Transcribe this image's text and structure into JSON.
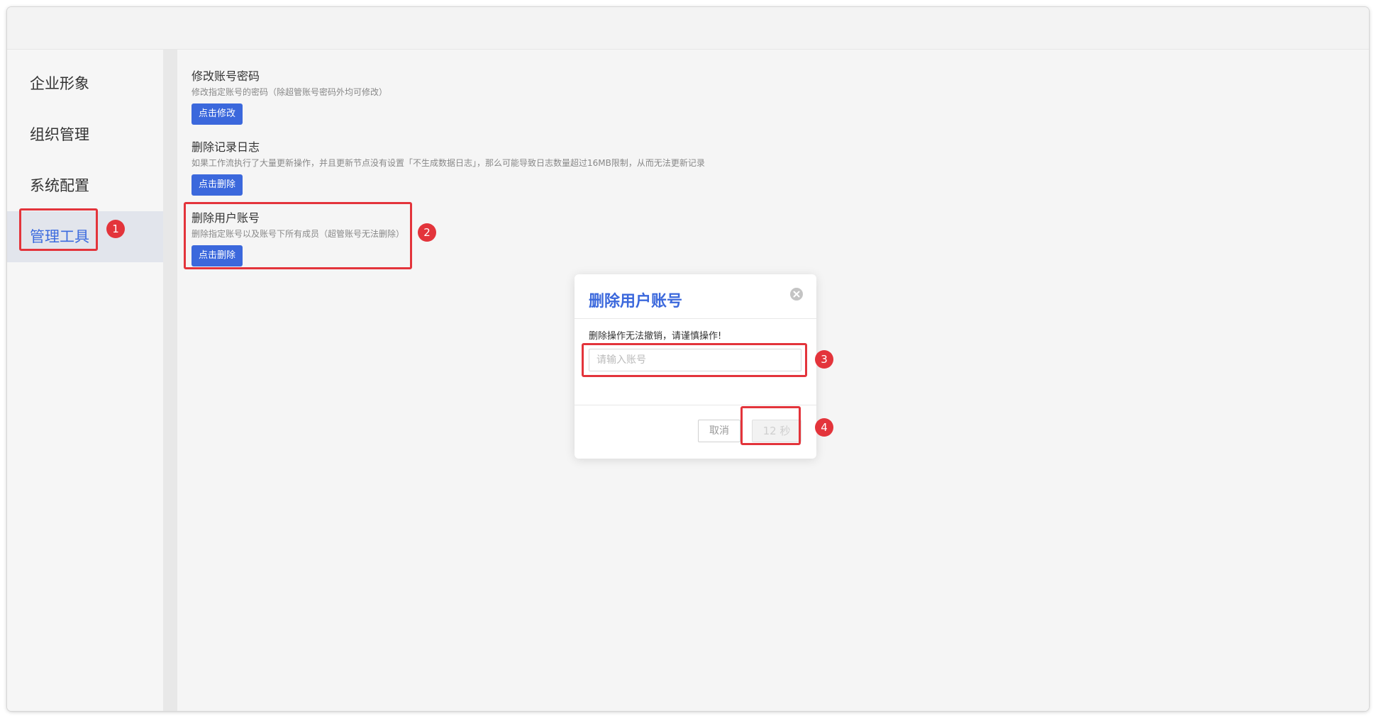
{
  "sidebar": {
    "items": [
      {
        "label": "企业形象",
        "active": false
      },
      {
        "label": "组织管理",
        "active": false
      },
      {
        "label": "系统配置",
        "active": false
      },
      {
        "label": "管理工具",
        "active": true
      }
    ]
  },
  "main": {
    "sections": [
      {
        "title": "修改账号密码",
        "desc": "修改指定账号的密码（除超管账号密码外均可修改）",
        "button": "点击修改"
      },
      {
        "title": "删除记录日志",
        "desc": "如果工作流执行了大量更新操作，并且更新节点没有设置「不生成数据日志」，那么可能导致日志数量超过16MB限制，从而无法更新记录",
        "button": "点击删除"
      },
      {
        "title": "删除用户账号",
        "desc": "删除指定账号以及账号下所有成员（超管账号无法删除）",
        "button": "点击删除"
      }
    ]
  },
  "modal": {
    "title": "删除用户账号",
    "warning": "删除操作无法撤销，请谨慎操作!",
    "input_placeholder": "请输入账号",
    "cancel_label": "取消",
    "confirm_label": "12 秒"
  },
  "annotations": [
    "1",
    "2",
    "3",
    "4"
  ],
  "colors": {
    "accent": "#3b68dc",
    "highlight": "#e3343b"
  }
}
